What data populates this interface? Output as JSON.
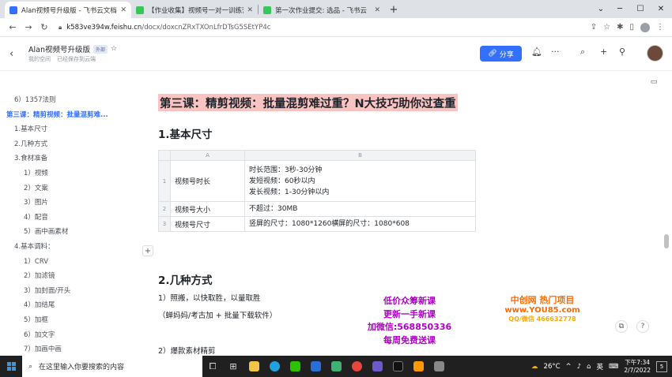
{
  "browser": {
    "tabs": [
      {
        "title": "Alan视频号升级版 - 飞书云文档",
        "color": "#3370ff",
        "active": true
      },
      {
        "title": "【作业收集】视频号一对一训练营",
        "color": "#34c759",
        "active": false
      },
      {
        "title": "第一次作业提交: 选品 - 飞书云",
        "color": "#34c759",
        "active": false
      }
    ],
    "new_tab": "+",
    "url_host": "k583ve394w.feishu.cn",
    "url_path": "/docx/doxcnZRxTXOnLfrDTsG5SEtYP4c"
  },
  "doc": {
    "title": "Alan视频号升级版",
    "tag": "外部",
    "space": "我的空间",
    "save_status": "已经保存到云端",
    "share_label": "分享"
  },
  "outline": [
    {
      "label": "6）1357法则",
      "indent": 1,
      "active": false
    },
    {
      "label": "第三课：精剪视频：批量混剪难...",
      "indent": 0,
      "active": true
    },
    {
      "label": "1.基本尺寸",
      "indent": 1,
      "active": false
    },
    {
      "label": "2.几种方式",
      "indent": 1,
      "active": false
    },
    {
      "label": "3.食材准备",
      "indent": 1,
      "active": false
    },
    {
      "label": "1）视频",
      "indent": 2,
      "active": false
    },
    {
      "label": "2）文案",
      "indent": 2,
      "active": false
    },
    {
      "label": "3）图片",
      "indent": 2,
      "active": false
    },
    {
      "label": "4）配音",
      "indent": 2,
      "active": false
    },
    {
      "label": "5）画中画素材",
      "indent": 2,
      "active": false
    },
    {
      "label": "4.基本调料：",
      "indent": 1,
      "active": false
    },
    {
      "label": "1）CRV",
      "indent": 2,
      "active": false
    },
    {
      "label": "2）加滤镜",
      "indent": 2,
      "active": false
    },
    {
      "label": "3）加封面/开头",
      "indent": 2,
      "active": false
    },
    {
      "label": "4）加结尾",
      "indent": 2,
      "active": false
    },
    {
      "label": "5）加框",
      "indent": 2,
      "active": false
    },
    {
      "label": "6）加文字",
      "indent": 2,
      "active": false
    },
    {
      "label": "7）加画中画",
      "indent": 2,
      "active": false
    }
  ],
  "content": {
    "lesson_heading": "第三课：精剪视频：批量混剪难过重？N大技巧助你过查重",
    "section1": "1.基本尺寸",
    "table": {
      "columns": [
        "A",
        "B"
      ],
      "rows": [
        {
          "num": "1",
          "a": "视频号时长",
          "b": [
            "时长范围：3秒-30分钟",
            "发短视频：60秒以内",
            "发长视频：1-30分钟以内"
          ]
        },
        {
          "num": "2",
          "a": "视频号大小",
          "b": [
            "不超过：30MB"
          ]
        },
        {
          "num": "3",
          "a": "视频号尺寸",
          "b": [
            "竖屏的尺寸：1080*1260横屏的尺寸：1080*608"
          ]
        }
      ]
    },
    "section2": "2.几种方式",
    "p1": "1）照搬，以快取胜，以量取胜",
    "p2": "（蝉妈妈/考古加 + 批量下载软件）",
    "p3": "2）爆款素材精剪"
  },
  "overlay": {
    "promo_lines": [
      "低价众筹新课",
      "更新一手新课",
      "加微信:568850336",
      "每周免费送课"
    ],
    "brand_lines": [
      "中创网 热门项目",
      "www.YOU85.com",
      "QQ/微信 466632778"
    ]
  },
  "taskbar": {
    "search_placeholder": "在这里输入你要搜索的内容",
    "temperature": "26°C",
    "ime": "英",
    "time": "下午7:34",
    "date": "2/7/2022",
    "notifications": "5"
  }
}
